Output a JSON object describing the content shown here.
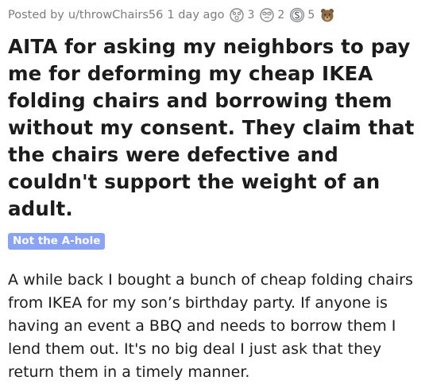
{
  "post": {
    "posted_by": "Posted by",
    "username": "u/throwChairs56",
    "time_ago": "1 day ago",
    "awards": [
      {
        "icon": "shocked-face-award-icon",
        "count": "3"
      },
      {
        "icon": "rolling-eyes-award-icon",
        "count": "2"
      },
      {
        "icon": "silver-coin-award-icon",
        "count": "5"
      },
      {
        "icon": "bear-face-award-icon",
        "count": ""
      }
    ],
    "title": "AITA for asking my neighbors to pay me for deforming my cheap IKEA folding chairs and borrowing them without my consent. They claim that the chairs were defective and couldn't support the weight of an adult.",
    "flair": "Not the A-hole",
    "flair_color": "#8ba3f4",
    "body": "A while back I bought a bunch of cheap folding chairs from IKEA for my son’s birthday party. If anyone is having an event a BBQ and needs to borrow them I lend them out. It's no big deal I just ask that they return them in a timely manner."
  }
}
